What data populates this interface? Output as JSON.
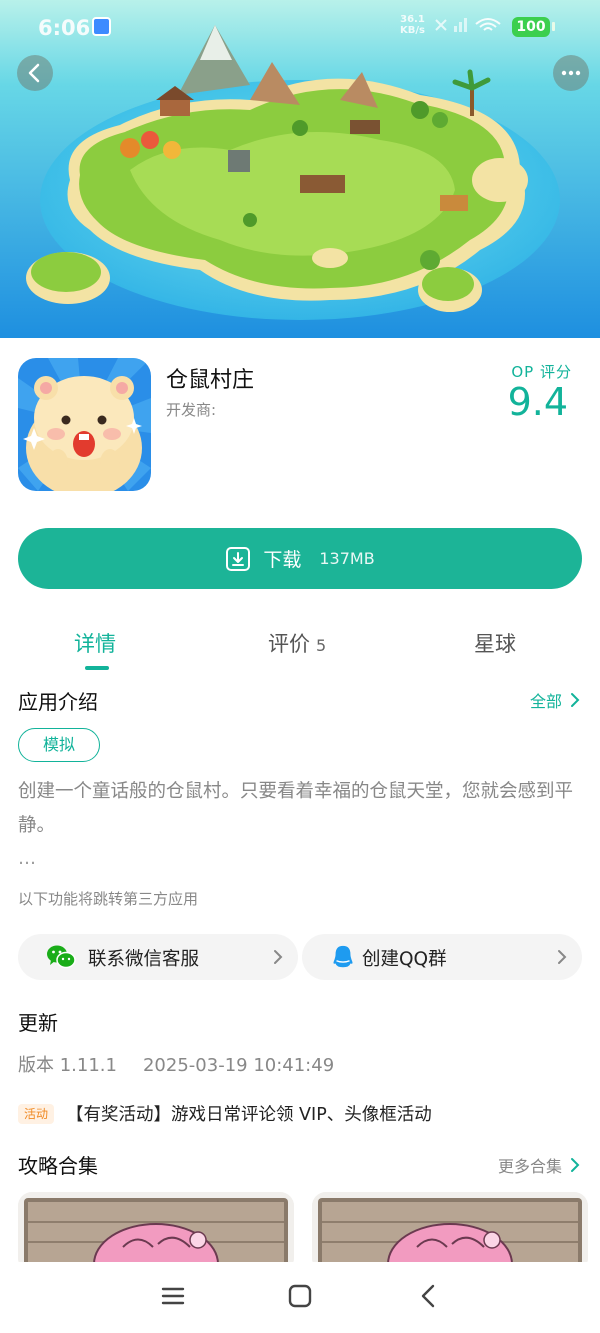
{
  "status_bar": {
    "time": "6:06",
    "network_speed_value": "36.1",
    "network_speed_unit": "KB/s",
    "battery": "100"
  },
  "hero": {
    "image": "island-village-scene"
  },
  "app": {
    "name": "仓鼠村庄",
    "developer_label": "开发商:",
    "score_label": "OP 评分",
    "score_value": "9.4",
    "icon": "hamster-app-icon"
  },
  "download": {
    "label": "下载",
    "size": "137MB",
    "icon": "download-icon"
  },
  "tabs": [
    {
      "label": "详情",
      "active": true
    },
    {
      "label": "评价",
      "count": "5",
      "active": false
    },
    {
      "label": "星球",
      "active": false
    }
  ],
  "intro": {
    "title": "应用介绍",
    "all_link": "全部",
    "tag": "模拟",
    "description": "创建一个童话般的仓鼠村。只要看着幸福的仓鼠天堂，您就会感到平静。",
    "ellipsis": "…",
    "third_party_note": "以下功能将跳转第三方应用",
    "contacts": [
      {
        "label": "联系微信客服",
        "icon": "wechat-icon"
      },
      {
        "label": "创建QQ群",
        "icon": "qq-icon"
      }
    ]
  },
  "update": {
    "title": "更新",
    "version": "版本 1.11.1",
    "datetime": "2025-03-19 10:41:49",
    "activity_badge": "活动",
    "activity_text": "【有奖活动】游戏日常评论领 VIP、头像框活动"
  },
  "guides": {
    "title": "攻略合集",
    "more_link": "更多合集"
  },
  "colors": {
    "accent": "#1cb497",
    "text_secondary": "#888888",
    "activity": "#f08a24"
  }
}
